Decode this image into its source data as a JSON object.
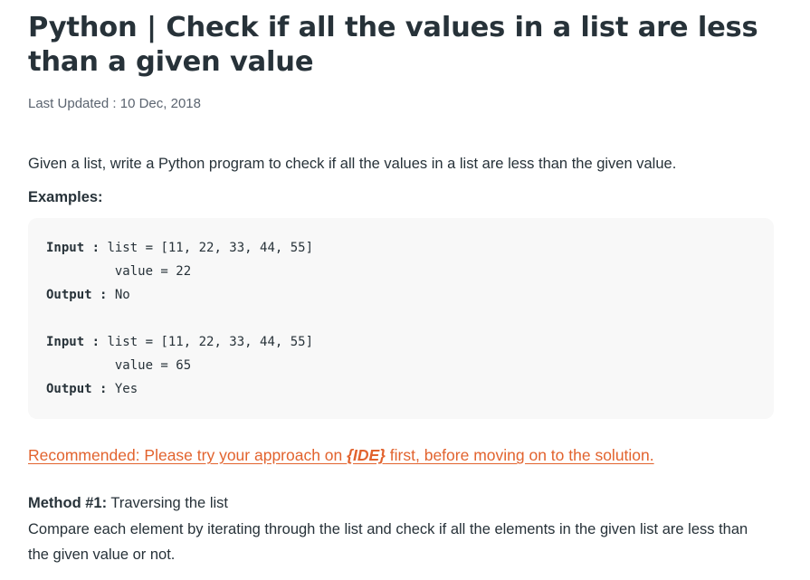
{
  "article": {
    "title": "Python | Check if all the values in a list are less than a given value",
    "last_updated": "Last Updated : 10 Dec, 2018",
    "intro": "Given a list, write a Python program to check if all the values in a list are less than the given value.",
    "examples_heading": "Examples:",
    "code_lines": [
      {
        "key": "Input :",
        "rest": " list = [11, 22, 33, 44, 55]"
      },
      {
        "key": "",
        "rest": "         value = 22"
      },
      {
        "key": "Output :",
        "rest": " No"
      },
      {
        "key": "",
        "rest": ""
      },
      {
        "key": "Input :",
        "rest": " list = [11, 22, 33, 44, 55]"
      },
      {
        "key": "",
        "rest": "         value = 65"
      },
      {
        "key": "Output :",
        "rest": " Yes"
      }
    ],
    "recommendation": {
      "prefix": "Recommended: Please try your approach on ",
      "ide": "{IDE}",
      "suffix": " first, before moving on to the solution."
    },
    "method": {
      "label": "Method #1:",
      "name": " Traversing the list"
    },
    "method_description": "Compare each element by iterating through the list and check if all the elements in the given list are less than the given value or not."
  },
  "colors": {
    "text": "#273239",
    "muted": "#5b6470",
    "link": "#e2632e",
    "code_background": "#f8f8f8"
  }
}
